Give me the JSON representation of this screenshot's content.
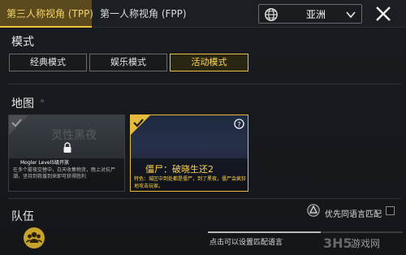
{
  "tabs": [
    {
      "label": "第三人称视角 (TPP)",
      "active": true
    },
    {
      "label": "第一人称视角 (FPP)",
      "active": false
    }
  ],
  "region": {
    "label": "亚洲",
    "icon": "globe-icon"
  },
  "close_icon": "close-icon",
  "mode": {
    "heading": "模式",
    "buttons": [
      {
        "label": "经典模式",
        "selected": false
      },
      {
        "label": "娱乐模式",
        "selected": false
      },
      {
        "label": "活动模式",
        "selected": true
      }
    ]
  },
  "map": {
    "heading": "地图",
    "cards": [
      {
        "watermark": "灵性黑夜",
        "lock_text": "Mogler Level5级开放",
        "description": "在多个雾夜交替中，白天收集物资，晚上对抗尸潮，坚持到救援到来即可获得胜利"
      },
      {
        "title": "僵尸：破晓生还2",
        "description": "特色：城区中到处都是僵尸，到了黑夜，僵尸会疯狂地攻击玩家。",
        "selected": true
      }
    ]
  },
  "team": {
    "heading": "队伍",
    "auto_match_label": "优先同语言匹配",
    "hint": "点击可以设置匹配语言",
    "progress": 0.58
  },
  "watermark_brand": {
    "text": "游戏网"
  },
  "colors": {
    "accent": "#f0c23a",
    "selected_text": "#ffd95a"
  }
}
